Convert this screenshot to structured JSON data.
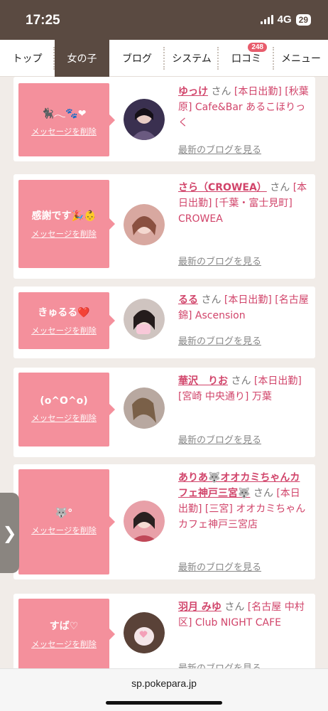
{
  "status": {
    "time": "17:25",
    "network": "4G",
    "battery": "29"
  },
  "nav": {
    "items": [
      {
        "label": "トップ"
      },
      {
        "label": "女の子"
      },
      {
        "label": "ブログ"
      },
      {
        "label": "システム"
      },
      {
        "label": "口コミ",
        "badge": "248"
      },
      {
        "label": "メニュー"
      }
    ],
    "active_index": 1
  },
  "messages": [
    {
      "message": "🐈‍⬛𓂃🐾❤",
      "delete_label": "メッセージを削除",
      "name": "ゆっけ",
      "san": "さん",
      "details": "[本日出勤] [秋葉原] Cafe&Bar あるこほりっく",
      "blog_link": "最新のブログを見る"
    },
    {
      "message": "感謝です🎉👶",
      "delete_label": "メッセージを削除",
      "name": "さら（CROWEA）",
      "san": "さん",
      "details": "[本日出勤] [千葉・富士見町] CROWEA",
      "blog_link": "最新のブログを見る"
    },
    {
      "message": "きゅるる❤️",
      "delete_label": "メッセージを削除",
      "name": "るる",
      "san": "さん",
      "details": "[本日出勤] [名古屋 錦] Ascension",
      "blog_link": "最新のブログを見る"
    },
    {
      "message": "(o^O^o)",
      "delete_label": "メッセージを削除",
      "name": "華沢　りお",
      "san": "さん",
      "details": "[本日出勤] [宮崎 中央通り] 万葉",
      "blog_link": "最新のブログを見る"
    },
    {
      "message": "🐺°",
      "delete_label": "メッセージを削除",
      "name": "ありあ🐺オオカミちゃんカフェ神戸三宮🐺",
      "san": "さん",
      "details": "[本日出勤] [三宮] オオカミちゃんカフェ神戸三宮店",
      "blog_link": "最新のブログを見る"
    },
    {
      "message": "すば♡",
      "delete_label": "メッセージを削除",
      "name": "羽月 みゆ",
      "san": "さん",
      "details": "[名古屋 中村区] Club NIGHT CAFE",
      "blog_link": "最新のブログを見る"
    }
  ],
  "side_tab": {
    "label": "❯"
  },
  "browser": {
    "url": "sp.pokepara.jp"
  }
}
